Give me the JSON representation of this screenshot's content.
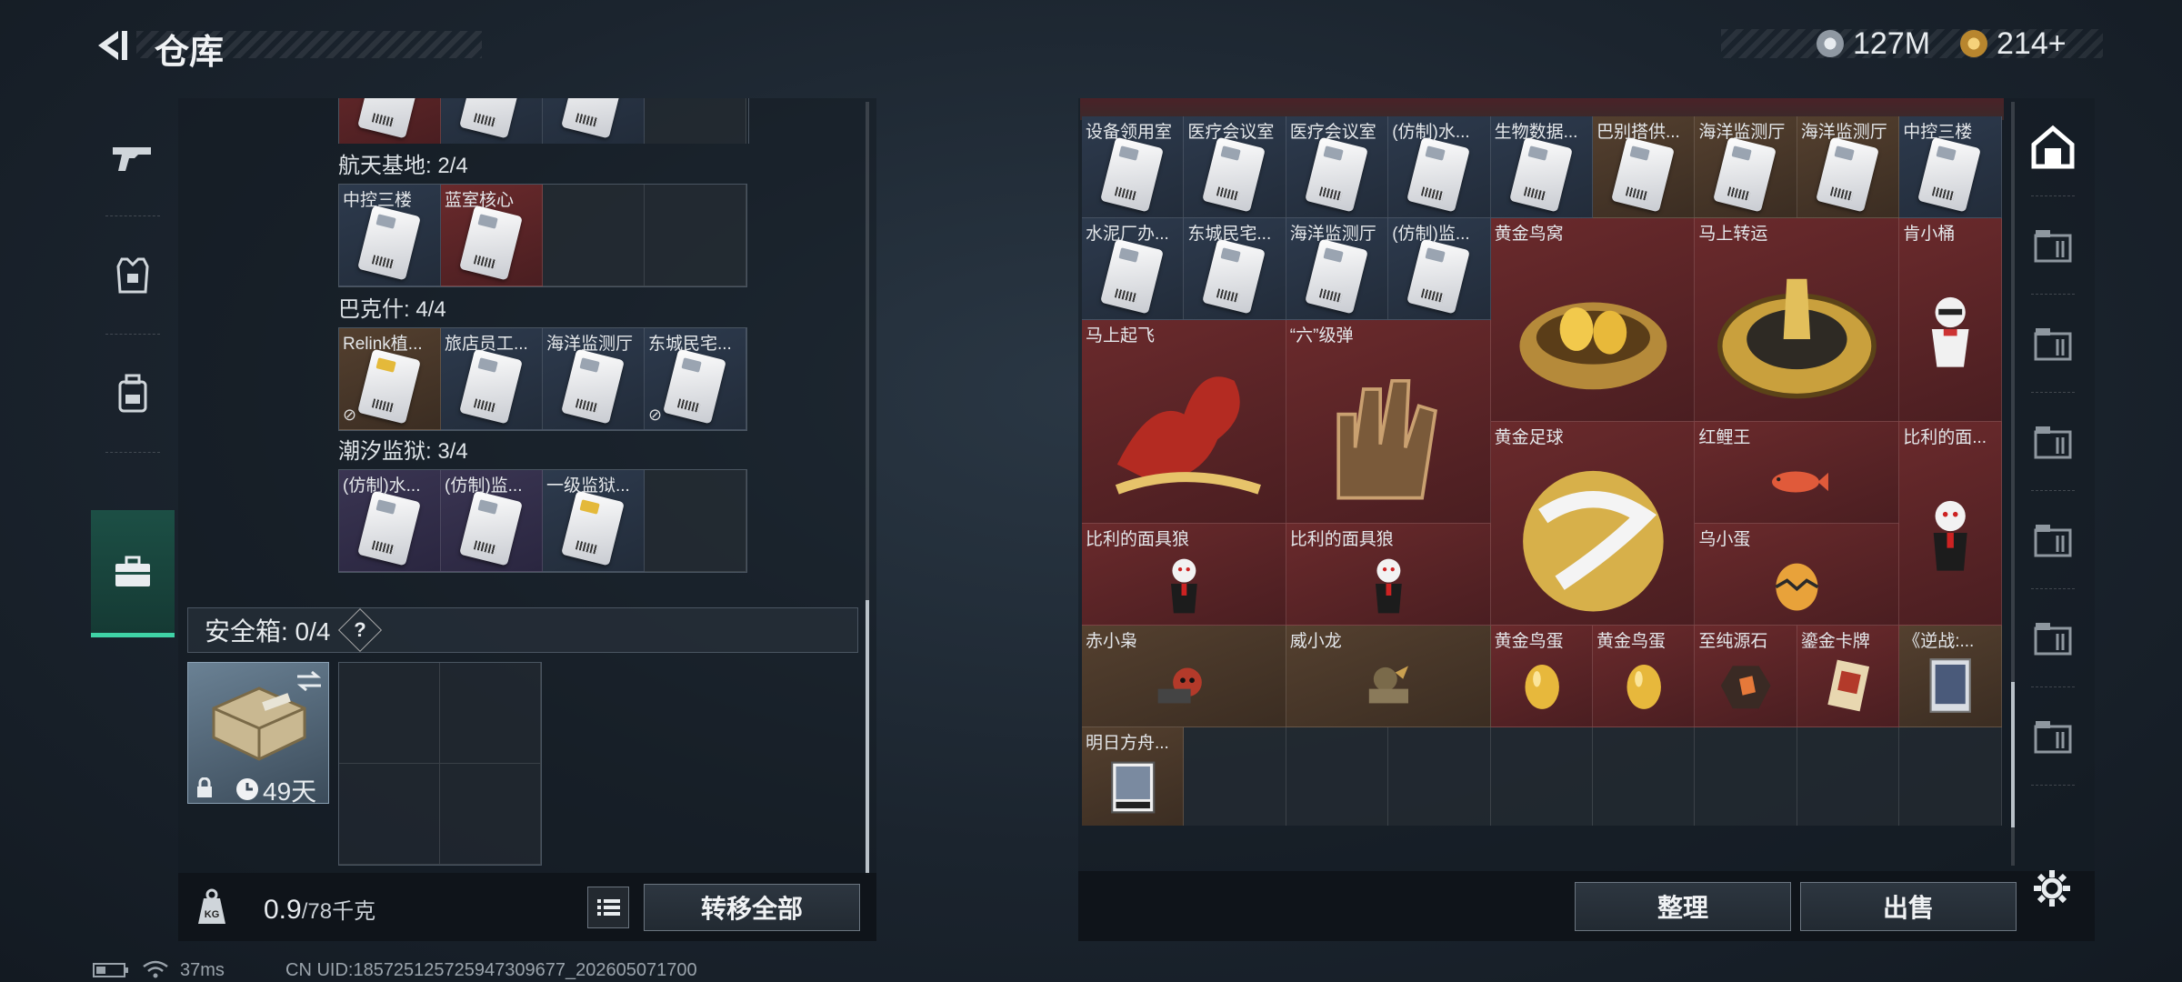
{
  "header": {
    "title": "仓库",
    "currencies": [
      {
        "icon": "silver-coin-icon",
        "value": "127M",
        "color": "#b9c0c8"
      },
      {
        "icon": "gold-coin-icon",
        "value": "214+",
        "color": "#d9a441"
      }
    ]
  },
  "left_tabs": [
    {
      "icon": "gun-icon",
      "active": false
    },
    {
      "icon": "armor-vest-icon",
      "active": false
    },
    {
      "icon": "backpack-icon",
      "active": false
    },
    {
      "icon": "briefcase-icon",
      "active": true
    }
  ],
  "key_sections": [
    {
      "title": "航天基地: 2/4",
      "items": [
        {
          "label": "中控三楼",
          "color": "blue"
        },
        {
          "label": "蓝室核心",
          "color": "red"
        },
        {
          "label": "",
          "color": "empty"
        },
        {
          "label": "",
          "color": "empty"
        }
      ]
    },
    {
      "title": "巴克什: 4/4",
      "items": [
        {
          "label": "Relink植...",
          "color": "brown",
          "gold": true,
          "nolink": true
        },
        {
          "label": "旅店员工...",
          "color": "blue"
        },
        {
          "label": "海洋监测厅",
          "color": "blue"
        },
        {
          "label": "东城民宅...",
          "color": "blue",
          "nolink": true
        }
      ]
    },
    {
      "title": "潮汐监狱: 3/4",
      "items": [
        {
          "label": "(仿制)水...",
          "color": "purple"
        },
        {
          "label": "(仿制)监...",
          "color": "purple"
        },
        {
          "label": "一级监狱...",
          "color": "blue",
          "gold": true
        },
        {
          "label": "",
          "color": "empty"
        }
      ]
    }
  ],
  "safe_box": {
    "label": "安全箱: 0/4",
    "help": "?",
    "duration": "49天"
  },
  "left_footer": {
    "weight_icon": "weight-kg-icon",
    "weight_value": "0.9",
    "weight_capacity": "/78千克",
    "transfer_all": "转移全部"
  },
  "stash_small_row1": [
    "设备领用室",
    "医疗会议室",
    "医疗会议室",
    "(仿制)水...",
    "生物数据...",
    "巴别搭供...",
    "海洋监测厅",
    "海洋监测厅",
    "中控三楼"
  ],
  "stash_small_row2": [
    "水泥厂办...",
    "东城民宅...",
    "海洋监测厅",
    "(仿制)监..."
  ],
  "stash_big_items": [
    {
      "label": "黄金鸟窝",
      "icon": "golden-nest-icon"
    },
    {
      "label": "马上转运",
      "icon": "golden-wheel-icon"
    },
    {
      "label": "肯小桶",
      "icon": "colonel-figure-icon"
    },
    {
      "label": "马上起飞",
      "icon": "red-horse-icon"
    },
    {
      "label": "“六”级弹",
      "icon": "bronze-hand-icon"
    },
    {
      "label": "黄金足球",
      "icon": "golden-football-icon"
    },
    {
      "label": "红鲤王",
      "icon": "red-carp-icon"
    },
    {
      "label": "比利的面...",
      "icon": "billy-puppet-icon"
    },
    {
      "label": "比利的面具狼",
      "icon": "billy-puppet-icon"
    },
    {
      "label": "比利的面具狼",
      "icon": "billy-puppet-icon"
    },
    {
      "label": "乌小蛋",
      "icon": "egg-figure-icon"
    },
    {
      "label": "赤小枭",
      "icon": "red-owl-figure-icon"
    },
    {
      "label": "威小龙",
      "icon": "dragon-figure-icon"
    },
    {
      "label": "黄金鸟蛋",
      "icon": "golden-egg-icon"
    },
    {
      "label": "黄金鸟蛋",
      "icon": "golden-egg-icon"
    },
    {
      "label": "至纯源石",
      "icon": "ore-stone-icon"
    },
    {
      "label": "鎏金卡牌",
      "icon": "gold-card-icon"
    },
    {
      "label": "《逆战:...",
      "icon": "game-box-icon"
    },
    {
      "label": "明日方舟...",
      "icon": "album-icon"
    }
  ],
  "right_footer": {
    "sort": "整理",
    "sell": "出售"
  },
  "right_sidebar": [
    "home-stash-icon",
    "stash-tab-4-icon",
    "stash-tab-4b-icon",
    "stash-tab-4-add-icon",
    "stash-tab-3-icon",
    "stash-tab-5-icon",
    "stash-tab-3b-icon"
  ],
  "status": {
    "ping": "37ms",
    "uid": "CN UID:18572512572594730967​7_202605071700"
  }
}
